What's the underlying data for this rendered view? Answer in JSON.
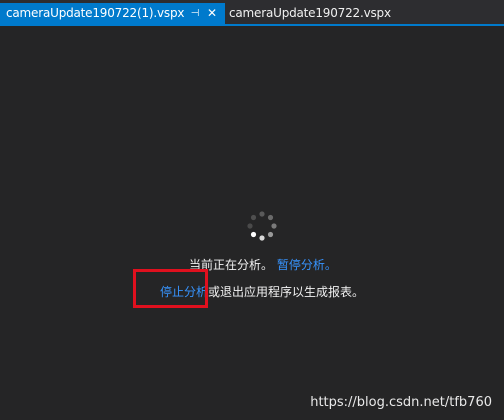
{
  "tabs": [
    {
      "label": "cameraUpdate190722(1).vspx",
      "active": true,
      "pin_glyph": "⊣",
      "close_glyph": "✕"
    },
    {
      "label": "cameraUpdate190722.vspx",
      "active": false
    }
  ],
  "analysis": {
    "status_text": "当前正在分析。",
    "pause_link": "暂停分析。",
    "stop_link": "停止分析",
    "stop_suffix": "或退出应用程序以生成报表。"
  },
  "watermark": "https://blog.csdn.net/tfb760",
  "colors": {
    "accent": "#007acc",
    "link": "#3794ff",
    "highlight": "#e0101e",
    "background": "#252526"
  },
  "icons": {
    "spinner": "loading-spinner-icon",
    "pin": "pin-icon",
    "close": "close-icon"
  }
}
